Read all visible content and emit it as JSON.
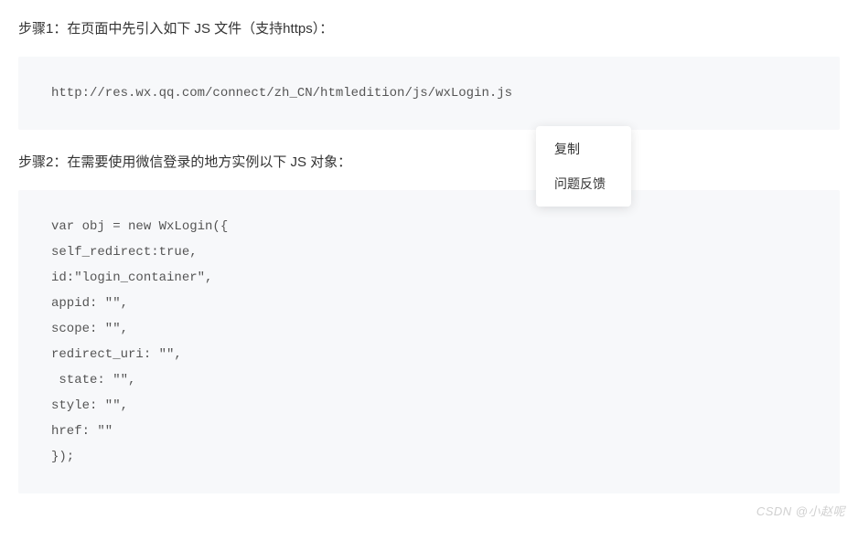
{
  "step1": {
    "text": "步骤1：在页面中先引入如下 JS 文件（支持https）：",
    "code": "http://res.wx.qq.com/connect/zh_CN/htmledition/js/wxLogin.js"
  },
  "step2": {
    "text": "步骤2：在需要使用微信登录的地方实例以下 JS 对象：",
    "code": "var obj = new WxLogin({\nself_redirect:true,\nid:\"login_container\", \nappid: \"\", \nscope: \"\", \nredirect_uri: \"\",\n state: \"\",\nstyle: \"\",\nhref: \"\"\n});"
  },
  "context_menu": {
    "items": [
      {
        "label": "复制"
      },
      {
        "label": "问题反馈"
      }
    ]
  },
  "watermark": "CSDN @小赵呢"
}
